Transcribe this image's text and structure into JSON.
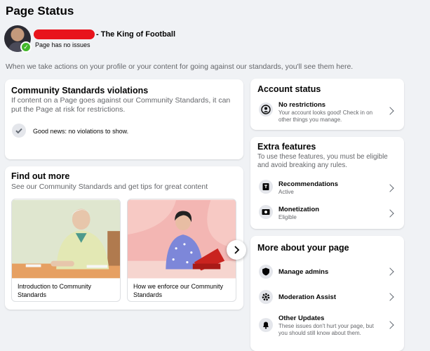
{
  "header": {
    "title": "Page Status",
    "page_name": "- The King of Football",
    "page_status": "Page has no issues",
    "intro": "When we take actions on your profile or your content for going against our standards, you'll see them here."
  },
  "violations": {
    "title": "Community Standards violations",
    "subtitle": "If content on a Page goes against our Community Standards, it can put the Page at risk for restrictions.",
    "status": "Good news: no violations to show."
  },
  "find_out_more": {
    "title": "Find out more",
    "subtitle": "See our Community Standards and get tips for great content",
    "tiles": [
      {
        "caption": "Introduction to Community Standards"
      },
      {
        "caption": "How we enforce our Community Standards"
      }
    ]
  },
  "account_status": {
    "title": "Account status",
    "item_title": "No restrictions",
    "item_sub": "Your account looks good! Check in on other things you manage."
  },
  "extra_features": {
    "title": "Extra features",
    "subtitle": "To use these features, you must be eligible and avoid breaking any rules.",
    "items": [
      {
        "title": "Recommendations",
        "sub": "Active",
        "icon": "recommendations-icon"
      },
      {
        "title": "Monetization",
        "sub": "Eligible",
        "icon": "monetization-icon"
      }
    ]
  },
  "more_about": {
    "title": "More about your page",
    "items": [
      {
        "title": "Manage admins",
        "icon": "shield-icon"
      },
      {
        "title": "Moderation Assist",
        "icon": "gear-icon"
      },
      {
        "title": "Other Updates",
        "sub": "These issues don't hurt your page, but you should still know about them.",
        "icon": "bell-icon"
      }
    ]
  },
  "colors": {
    "accent_green": "#42b72a",
    "redaction": "#e8141c",
    "background": "#f0f2f5"
  }
}
